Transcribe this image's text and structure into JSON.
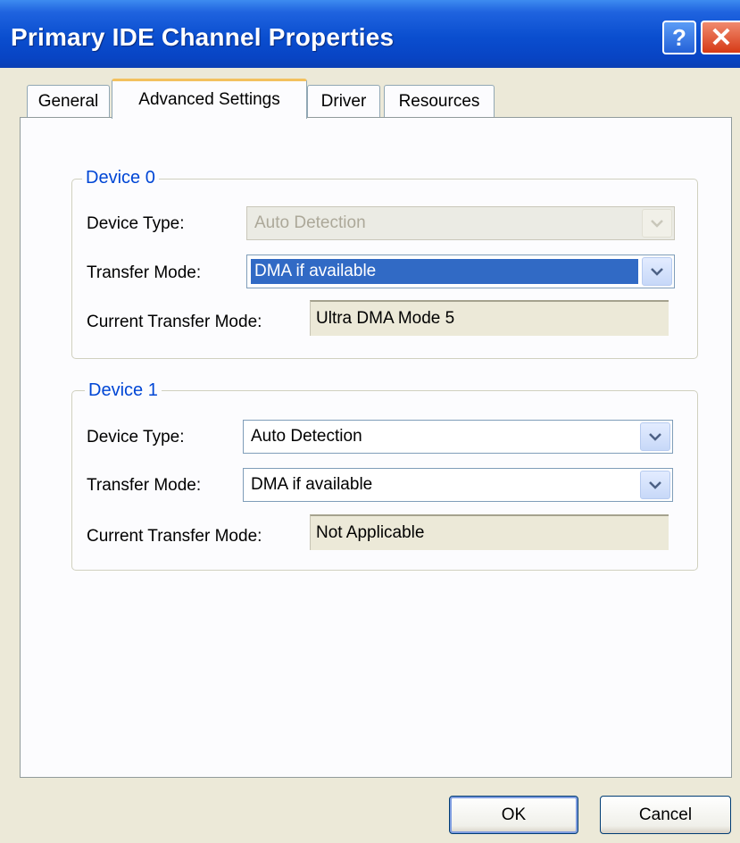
{
  "window": {
    "title": "Primary IDE Channel Properties",
    "help_glyph": "?",
    "close_glyph": "✕"
  },
  "tabs": [
    {
      "label": "General",
      "active": false
    },
    {
      "label": "Advanced Settings",
      "active": true
    },
    {
      "label": "Driver",
      "active": false
    },
    {
      "label": "Resources",
      "active": false
    }
  ],
  "device0": {
    "legend": "Device 0",
    "device_type_label": "Device Type:",
    "device_type_value": "Auto Detection",
    "transfer_mode_label": "Transfer Mode:",
    "transfer_mode_value": "DMA if available",
    "current_mode_label": "Current Transfer Mode:",
    "current_mode_value": "Ultra DMA Mode 5"
  },
  "device1": {
    "legend": "Device 1",
    "device_type_label": "Device Type:",
    "device_type_value": "Auto Detection",
    "transfer_mode_label": "Transfer Mode:",
    "transfer_mode_value": "DMA if available",
    "current_mode_label": "Current Transfer Mode:",
    "current_mode_value": "Not Applicable"
  },
  "buttons": {
    "ok": "OK",
    "cancel": "Cancel"
  },
  "icons": {
    "dropdown": "chevron-down-icon",
    "help": "help-icon",
    "close": "close-icon"
  },
  "colors": {
    "titlebar": "#0a4ecf",
    "selection": "#316ac5",
    "group_legend": "#0046d5",
    "dialog_bg": "#ece9d8"
  }
}
